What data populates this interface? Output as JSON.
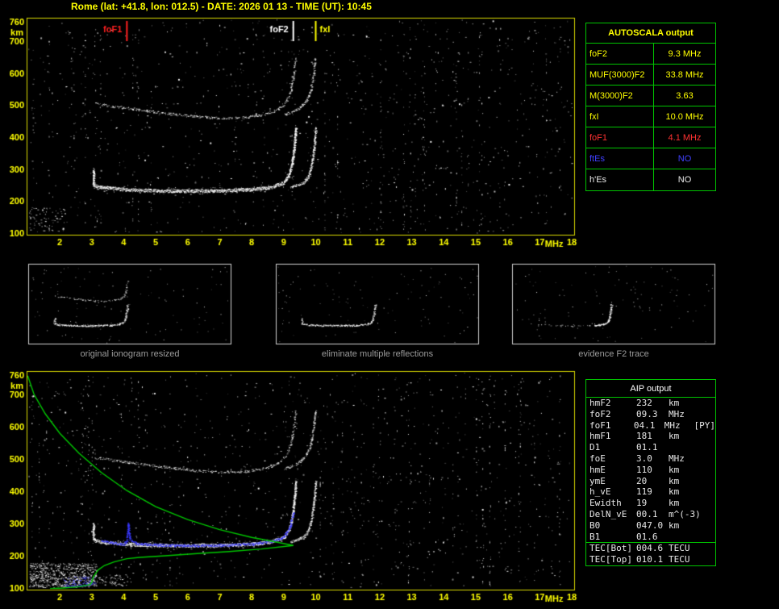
{
  "title": "Rome (lat: +41.8, lon: 012.5) - DATE: 2026 01 13 - TIME (UT): 10:45",
  "colors": {
    "accent_yellow": "#ffff00",
    "table_border_green": "#00c400",
    "profile_green": "#00c800",
    "marker_red": "#ff2020",
    "restored_blue": "#3a3aff",
    "caption_gray": "#9c9c9c"
  },
  "autoscala_table": {
    "header": "AUTOSCALA output",
    "rows": [
      {
        "label": "foF2",
        "value": "9.3 MHz",
        "color": "#ffff00"
      },
      {
        "label": "MUF(3000)F2",
        "value": "33.8 MHz",
        "color": "#ffff00"
      },
      {
        "label": "M(3000)F2",
        "value": "3.63",
        "color": "#ffff00"
      },
      {
        "label": "fxI",
        "value": "10.0 MHz",
        "color": "#ffff00"
      },
      {
        "label": "foF1",
        "value": "4.1 MHz",
        "color": "#ff3232"
      },
      {
        "label": "ftEs",
        "value": "NO",
        "color": "#4040ff"
      },
      {
        "label": "h'Es",
        "value": "NO",
        "color": "#e8e8e8"
      }
    ]
  },
  "thumbnails": [
    {
      "caption": "original ionogram resized"
    },
    {
      "caption": "eliminate multiple reflections"
    },
    {
      "caption": "evidence F2 trace"
    }
  ],
  "aip_table": {
    "header": "AIP output",
    "rows": [
      {
        "label": "hmF2",
        "value": "232",
        "unit": "km",
        "extra": ""
      },
      {
        "label": "foF2",
        "value": "09.3",
        "unit": "MHz",
        "extra": ""
      },
      {
        "label": "foF1",
        "value": "04.1",
        "unit": "MHz",
        "extra": "[PY]"
      },
      {
        "label": "hmF1",
        "value": "181",
        "unit": "km",
        "extra": ""
      },
      {
        "label": "D1",
        "value": "01.1",
        "unit": "",
        "extra": ""
      },
      {
        "label": "foE",
        "value": "3.0",
        "unit": "MHz",
        "extra": ""
      },
      {
        "label": "hmE",
        "value": "110",
        "unit": "km",
        "extra": ""
      },
      {
        "label": "ymE",
        "value": "20",
        "unit": "km",
        "extra": ""
      },
      {
        "label": "h_vE",
        "value": "119",
        "unit": "km",
        "extra": ""
      },
      {
        "label": "Ewidth",
        "value": "19",
        "unit": "km",
        "extra": ""
      },
      {
        "label": "DelN_vE",
        "value": "00.1",
        "unit": "m^(-3)",
        "extra": ""
      },
      {
        "label": "B0",
        "value": "047.0",
        "unit": "km",
        "extra": ""
      },
      {
        "label": "B1",
        "value": "01.6",
        "unit": "",
        "extra": ""
      }
    ],
    "tec_rows": [
      {
        "label": "TEC[Bot]",
        "value": "004.6",
        "unit": "TECU",
        "extra": ""
      },
      {
        "label": "TEC[Top]",
        "value": "010.1",
        "unit": "TECU",
        "extra": ""
      }
    ]
  },
  "chart_data": [
    {
      "id": "scaled_ionogram",
      "type": "scatter",
      "x_ticks": [
        2,
        3,
        4,
        5,
        6,
        7,
        8,
        9,
        10,
        11,
        12,
        13,
        14,
        15,
        16,
        17,
        18
      ],
      "x_unit": "MHz",
      "x_range": [
        2,
        18
      ],
      "y_ticks": [
        760,
        700,
        600,
        500,
        400,
        300,
        200,
        100
      ],
      "y_unit": "km",
      "y_range": [
        100,
        760
      ],
      "grid": false,
      "markers": [
        {
          "label": "foF1",
          "freq": 4.1,
          "color": "#ff2020",
          "side": "left"
        },
        {
          "label": "foF2",
          "freq": 9.3,
          "color": "#ffffff",
          "side": "left"
        },
        {
          "label": "fxI",
          "freq": 10.0,
          "color": "#ffff00",
          "side": "right"
        }
      ],
      "traces": {
        "f2_hop1": [
          [
            3.05,
            300
          ],
          [
            3.05,
            250
          ],
          [
            3.3,
            243
          ],
          [
            4,
            237
          ],
          [
            5,
            233
          ],
          [
            6,
            232
          ],
          [
            7,
            233
          ],
          [
            8,
            237
          ],
          [
            8.6,
            244
          ],
          [
            9,
            258
          ],
          [
            9.15,
            280
          ],
          [
            9.25,
            315
          ],
          [
            9.32,
            370
          ],
          [
            9.38,
            432
          ]
        ],
        "f2_hop2": [
          [
            3.1,
            505
          ],
          [
            3.7,
            496
          ],
          [
            4.4,
            487
          ],
          [
            5.2,
            476
          ],
          [
            6.2,
            465
          ],
          [
            7,
            460
          ],
          [
            7.8,
            462
          ],
          [
            8.4,
            471
          ],
          [
            8.8,
            486
          ],
          [
            9.05,
            508
          ],
          [
            9.2,
            540
          ],
          [
            9.3,
            592
          ],
          [
            9.36,
            648
          ]
        ]
      }
    },
    {
      "id": "restored_ionogram_with_profile",
      "type": "scatter",
      "x_ticks": [
        2,
        3,
        4,
        5,
        6,
        7,
        8,
        9,
        10,
        11,
        12,
        13,
        14,
        15,
        16,
        17,
        18
      ],
      "x_unit": "MHz",
      "x_range": [
        2,
        18
      ],
      "y_ticks": [
        760,
        700,
        600,
        500,
        400,
        300,
        200,
        100
      ],
      "y_unit": "km",
      "y_range": [
        100,
        760
      ],
      "grid": false,
      "markers": [],
      "traces": {
        "f2_hop1": [
          [
            3.05,
            300
          ],
          [
            3.05,
            250
          ],
          [
            3.3,
            243
          ],
          [
            4,
            237
          ],
          [
            5,
            233
          ],
          [
            6,
            232
          ],
          [
            7,
            233
          ],
          [
            8,
            237
          ],
          [
            8.6,
            244
          ],
          [
            9,
            258
          ],
          [
            9.15,
            280
          ],
          [
            9.25,
            315
          ],
          [
            9.32,
            370
          ],
          [
            9.38,
            432
          ]
        ],
        "f2_hop2": [
          [
            3.1,
            505
          ],
          [
            3.7,
            496
          ],
          [
            4.4,
            487
          ],
          [
            5.2,
            476
          ],
          [
            6.2,
            465
          ],
          [
            7,
            460
          ],
          [
            7.8,
            462
          ],
          [
            8.4,
            471
          ],
          [
            8.8,
            486
          ],
          [
            9.05,
            508
          ],
          [
            9.2,
            540
          ],
          [
            9.3,
            592
          ],
          [
            9.36,
            648
          ]
        ],
        "restored": [
          [
            3.3,
            248
          ],
          [
            3.7,
            240
          ],
          [
            4,
            236
          ],
          [
            4.1,
            250
          ],
          [
            4.14,
            300
          ],
          [
            4.18,
            252
          ],
          [
            4.4,
            238
          ],
          [
            5,
            234
          ],
          [
            6,
            232
          ],
          [
            7,
            233
          ],
          [
            8,
            237
          ],
          [
            8.7,
            247
          ],
          [
            9,
            260
          ],
          [
            9.2,
            292
          ],
          [
            9.3,
            335
          ]
        ],
        "restored_e": [
          [
            2.15,
            104
          ],
          [
            2.6,
            107
          ],
          [
            2.95,
            111
          ]
        ],
        "profile_topside": [
          [
            1.0,
            758
          ],
          [
            1.2,
            700
          ],
          [
            1.55,
            640
          ],
          [
            2.0,
            580
          ],
          [
            2.6,
            518
          ],
          [
            3.3,
            458
          ],
          [
            4.1,
            402
          ],
          [
            5.0,
            352
          ],
          [
            6.0,
            312
          ],
          [
            7.0,
            281
          ],
          [
            8.0,
            257
          ],
          [
            8.8,
            242
          ],
          [
            9.3,
            232
          ]
        ],
        "profile_bottomside": [
          [
            9.3,
            232
          ],
          [
            8.3,
            221
          ],
          [
            7.3,
            213
          ],
          [
            6.3,
            207
          ],
          [
            5.3,
            200
          ],
          [
            4.5,
            195
          ],
          [
            4.1,
            191
          ],
          [
            3.7,
            181
          ],
          [
            3.4,
            170
          ],
          [
            3.2,
            156
          ],
          [
            3.05,
            134
          ],
          [
            3.0,
            117
          ],
          [
            2.96,
            111
          ]
        ],
        "profile_e": [
          [
            2.96,
            111
          ],
          [
            2.6,
            104
          ],
          [
            2.1,
            100
          ],
          [
            1.7,
            98
          ]
        ]
      }
    }
  ]
}
